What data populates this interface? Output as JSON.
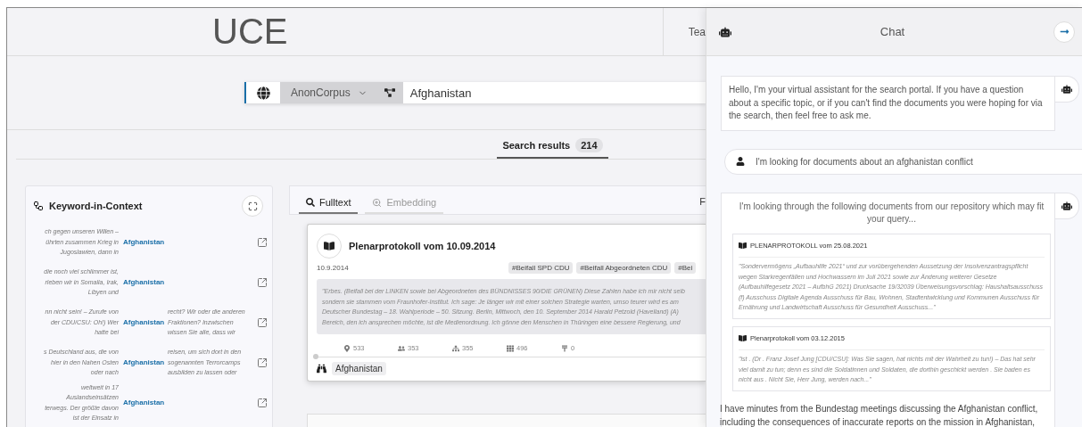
{
  "header": {
    "logo": "UCE",
    "nav_text": "Tea"
  },
  "search": {
    "corpus": "AnonCorpus",
    "query": "Afghanistan"
  },
  "results_tab": {
    "label": "Search results",
    "count": "214"
  },
  "kwic": {
    "title": "Keyword-in-Context",
    "rows": [
      {
        "left": [
          "ch gegen unseren Willen –",
          "ührten zusammen Krieg in",
          "Jugoslawien, dann in"
        ],
        "keyword": "Afghanistan",
        "right": []
      },
      {
        "left": [
          "die noch viel schlimmer ist,",
          "rleben wir in Somalia, Irak,",
          "Libyen und"
        ],
        "keyword": "Afghanistan",
        "right": []
      },
      {
        "left": [
          "nn nicht sein! – Zurufe von",
          "der CDU/CSU: Oh!) Wer",
          "hatte bei"
        ],
        "keyword": "Afghanistan",
        "right": [
          "recht? Wir oder die anderen",
          "Fraktionen? Inzwischen",
          "wissen Sie alle, dass wir"
        ]
      },
      {
        "left": [
          "s Deutschland aus, die von",
          "hier in den Nahen Osten",
          "oder nach"
        ],
        "keyword": "Afghanistan",
        "right": [
          "reisen, um sich dort in den",
          "sogenannten Terrorcamps",
          "ausbilden zu lassen oder"
        ]
      },
      {
        "left": [
          "weltweit in 17",
          "Auslandseinsätzen",
          "terwegs. Der größte davon",
          "ist der Einsatz in"
        ],
        "keyword": "Afghanistan",
        "right": []
      }
    ]
  },
  "search_modes": {
    "tabs": [
      {
        "label": "Fulltext",
        "selected": true
      },
      {
        "label": "Embedding",
        "selected": false
      }
    ],
    "right_text": "F"
  },
  "result": {
    "title": "Plenarprotokoll vom 10.09.2014",
    "date": "10.9.2014",
    "tags": [
      "#Beifall SPD CDU",
      "#Beifall Abgeordneten CDU",
      "#Bei"
    ],
    "snippet": [
      "\"Erbes. (Beifall bei der LINKEN sowie bei Abgeordneten des BÜNDNISSES 90/DIE GRÜNEN) Diese Zahlen habe ich mir nicht selb",
      "sondern sie stammen vom Fraunhofer-Institut. Ich sage: Je länger wir mit einer solchen Strategie warten, umso teurer wird es am",
      "Deutscher Bundestag – 18. Wahlperiode – 50. Sitzung. Berlin, Mittwoch, den 10. September 2014 Harald Petzold (Havelland) (A)",
      "Bereich, den ich ansprechen möchte, ist die Medienordnung. Ich gönne den Menschen in Thüringen eine bessere Regierung, und"
    ],
    "stats": [
      {
        "kind": "location",
        "value": "533"
      },
      {
        "kind": "persons",
        "value": "353"
      },
      {
        "kind": "organisations",
        "value": "355"
      },
      {
        "kind": "grid",
        "value": "496"
      },
      {
        "kind": "taxon",
        "value": "0"
      }
    ],
    "keyword": "Afghanistan"
  },
  "chat": {
    "title": "Chat",
    "messages": [
      {
        "kind": "bot",
        "text": "Hello, I'm your virtual assistant for the search portal. If you have a question about a specific topic, or if you can't find the documents you were hoping for via the search, then feel free to ask me."
      },
      {
        "kind": "user",
        "text": "I'm looking for documents about an afghanistan conflict"
      },
      {
        "kind": "bot-docs",
        "text": "I'm looking through the following documents from our repository which may fit your query...",
        "documents": [
          {
            "title": "PLENARPROTOKOLL vom 25.08.2021",
            "excerpt": "\"Sondervermögens „Aufbauhilfe 2021“ und zur vorübergehenden Aussetzung der Insolvenzantragspflicht wegen Starkregenfällen und Hochwassern im Juli 2021 sowie zur Änderung weiterer Gesetze (Aufbauhilfegesetz 2021 – AufbhG 2021) Drucksache 19/32039 Überweisungsvorschlag: Haushaltsausschuss (f) Ausschuss Digitale Agenda Ausschuss für Bau, Wohnen, Stadtentwicklung und Kommunen Ausschuss für Ernährung und Landwirtschaft Ausschuss für Gesundheit Ausschuss...\""
          },
          {
            "title": "Plenarprotokoll vom 03.12.2015",
            "excerpt": "\"ist . (Dr . Franz Josef Jung [CDU/CSU]: Was Sie sagen, hat nichts mit der Wahrheit zu tun!) – Das hat sehr viel damit zu tun; denn es sind die Soldatinnen und Soldaten, die dorthin geschickt werden . Sie baden es nicht aus . Nicht Sie, Herr Jung, werden nach...\""
          }
        ],
        "answer": "I have minutes from the Bundestag meetings discussing the Afghanistan conflict, including the consequences of inaccurate reports on the mission in Afghanistan,"
      }
    ]
  }
}
